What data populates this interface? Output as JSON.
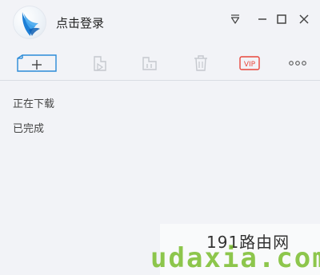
{
  "titlebar": {
    "login_label": "点击登录",
    "icons": [
      "app-logo-icon",
      "dropdown-menu-icon",
      "minimize-icon",
      "maximize-icon",
      "close-icon"
    ]
  },
  "toolbar": {
    "items": [
      {
        "name": "new-task-button",
        "icon": "new-task-icon",
        "enabled": true
      },
      {
        "name": "start-button",
        "icon": "start-icon",
        "enabled": false
      },
      {
        "name": "pause-button",
        "icon": "pause-icon",
        "enabled": false
      },
      {
        "name": "delete-button",
        "icon": "trash-icon",
        "enabled": false
      },
      {
        "name": "vip-button",
        "icon": "vip-icon",
        "label": "VIP",
        "enabled": true
      },
      {
        "name": "more-button",
        "icon": "more-icon",
        "label": "ooo",
        "enabled": true
      }
    ]
  },
  "nav": {
    "downloading": "正在下载",
    "completed": "已完成"
  },
  "watermark": {
    "top_text": "191路由网",
    "bottom_text": "udaxia.com"
  },
  "colors": {
    "background": "#f2f3f7",
    "accent_blue": "#2a8bd8",
    "vip_red": "#e8473c",
    "disabled_gray": "#c5c8ce",
    "watermark_green": "#7bbd2e"
  }
}
